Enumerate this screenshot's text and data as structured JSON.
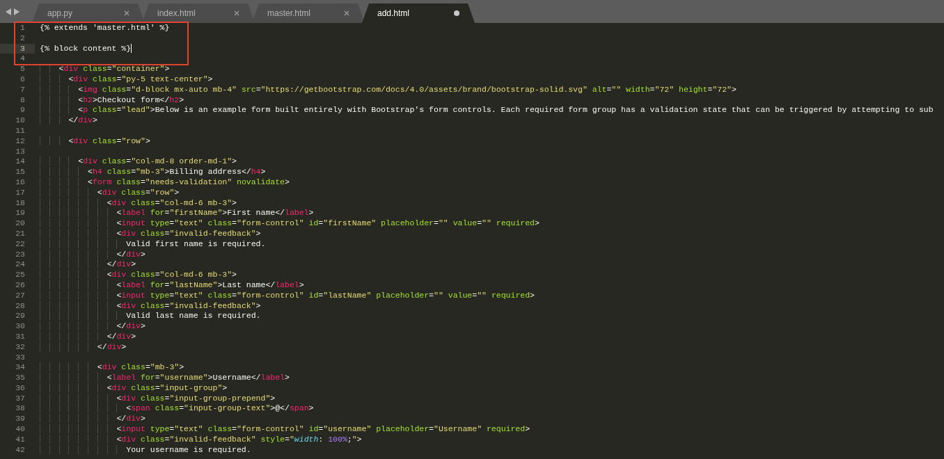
{
  "tabs": [
    {
      "label": "app.py",
      "selected": false,
      "dirty": false
    },
    {
      "label": "index.html",
      "selected": false,
      "dirty": false
    },
    {
      "label": "master.html",
      "selected": false,
      "dirty": false
    },
    {
      "label": "add.html",
      "selected": true,
      "dirty": true
    }
  ],
  "lines": [
    {
      "number": "1",
      "code": "{% extends 'master.html' %}",
      "current": false,
      "boxed": true
    },
    {
      "number": "2",
      "current": false,
      "boxed": true
    },
    {
      "number": "3",
      "code": "{% block content %}",
      "current": true,
      "boxed": true
    },
    {
      "number": "4",
      "current": false,
      "boxed": true
    },
    {
      "number": "5",
      "code": "    <div class=\"container\">",
      "current": false,
      "boxed": false
    },
    {
      "number": "6",
      "code": "      <div class=\"py-5 text-center\">",
      "current": false,
      "boxed": false
    },
    {
      "number": "7",
      "code": "        <img class=\"d-block mx-auto mb-4\" src=\"https://getbootstrap.com/docs/4.0/assets/brand/bootstrap-solid.svg\" alt=\"\" width=\"72\" height=\"72\">",
      "current": false,
      "boxed": false
    },
    {
      "number": "8",
      "code": "        <h2>Checkout form</h2>",
      "current": false,
      "boxed": false
    },
    {
      "number": "9",
      "code": "        <p class=\"lead\">Below is an example form built entirely with Bootstrap's form controls. Each required form group has a validation state that can be triggered by attempting to sub",
      "current": false,
      "boxed": false
    },
    {
      "number": "10",
      "code": "      </div>",
      "current": false,
      "boxed": false
    },
    {
      "number": "11",
      "current": false,
      "boxed": false
    },
    {
      "number": "12",
      "code": "      <div class=\"row\">",
      "current": false,
      "boxed": false
    },
    {
      "number": "13",
      "current": false,
      "boxed": false
    },
    {
      "number": "14",
      "code": "        <div class=\"col-md-8 order-md-1\">",
      "current": false,
      "boxed": false
    },
    {
      "number": "15",
      "code": "          <h4 class=\"mb-3\">Billing address</h4>",
      "current": false,
      "boxed": false
    },
    {
      "number": "16",
      "code": "          <form class=\"needs-validation\" novalidate>",
      "current": false,
      "boxed": false
    },
    {
      "number": "17",
      "code": "            <div class=\"row\">",
      "current": false,
      "boxed": false
    },
    {
      "number": "18",
      "code": "              <div class=\"col-md-6 mb-3\">",
      "current": false,
      "boxed": false
    },
    {
      "number": "19",
      "code": "                <label for=\"firstName\">First name</label>",
      "current": false,
      "boxed": false
    },
    {
      "number": "20",
      "code": "                <input type=\"text\" class=\"form-control\" id=\"firstName\" placeholder=\"\" value=\"\" required>",
      "current": false,
      "boxed": false
    },
    {
      "number": "21",
      "code": "                <div class=\"invalid-feedback\">",
      "current": false,
      "boxed": false
    },
    {
      "number": "22",
      "code": "                  Valid first name is required.",
      "current": false,
      "boxed": false
    },
    {
      "number": "23",
      "code": "                </div>",
      "current": false,
      "boxed": false
    },
    {
      "number": "24",
      "code": "              </div>",
      "current": false,
      "boxed": false
    },
    {
      "number": "25",
      "code": "              <div class=\"col-md-6 mb-3\">",
      "current": false,
      "boxed": false
    },
    {
      "number": "26",
      "code": "                <label for=\"lastName\">Last name</label>",
      "current": false,
      "boxed": false
    },
    {
      "number": "27",
      "code": "                <input type=\"text\" class=\"form-control\" id=\"lastName\" placeholder=\"\" value=\"\" required>",
      "current": false,
      "boxed": false
    },
    {
      "number": "28",
      "code": "                <div class=\"invalid-feedback\">",
      "current": false,
      "boxed": false
    },
    {
      "number": "29",
      "code": "                  Valid last name is required.",
      "current": false,
      "boxed": false
    },
    {
      "number": "30",
      "code": "                </div>",
      "current": false,
      "boxed": false
    },
    {
      "number": "31",
      "code": "              </div>",
      "current": false,
      "boxed": false
    },
    {
      "number": "32",
      "code": "            </div>",
      "current": false,
      "boxed": false
    },
    {
      "number": "33",
      "current": false,
      "boxed": false
    },
    {
      "number": "34",
      "code": "            <div class=\"mb-3\">",
      "current": false,
      "boxed": false
    },
    {
      "number": "35",
      "code": "              <label for=\"username\">Username</label>",
      "current": false,
      "boxed": false
    },
    {
      "number": "36",
      "code": "              <div class=\"input-group\">",
      "current": false,
      "boxed": false
    },
    {
      "number": "37",
      "code": "                <div class=\"input-group-prepend\">",
      "current": false,
      "boxed": false
    },
    {
      "number": "38",
      "code": "                  <span class=\"input-group-text\">@</span>",
      "current": false,
      "boxed": false
    },
    {
      "number": "39",
      "code": "                </div>",
      "current": false,
      "boxed": false
    },
    {
      "number": "40",
      "code": "                <input type=\"text\" class=\"form-control\" id=\"username\" placeholder=\"Username\" required>",
      "current": false,
      "boxed": false
    },
    {
      "number": "41",
      "code": "                <div class=\"invalid-feedback\" style=\"width: 100%;\">",
      "current": false,
      "boxed": false
    },
    {
      "number": "42",
      "code": "                  Your username is required.",
      "current": false,
      "boxed": false
    }
  ]
}
